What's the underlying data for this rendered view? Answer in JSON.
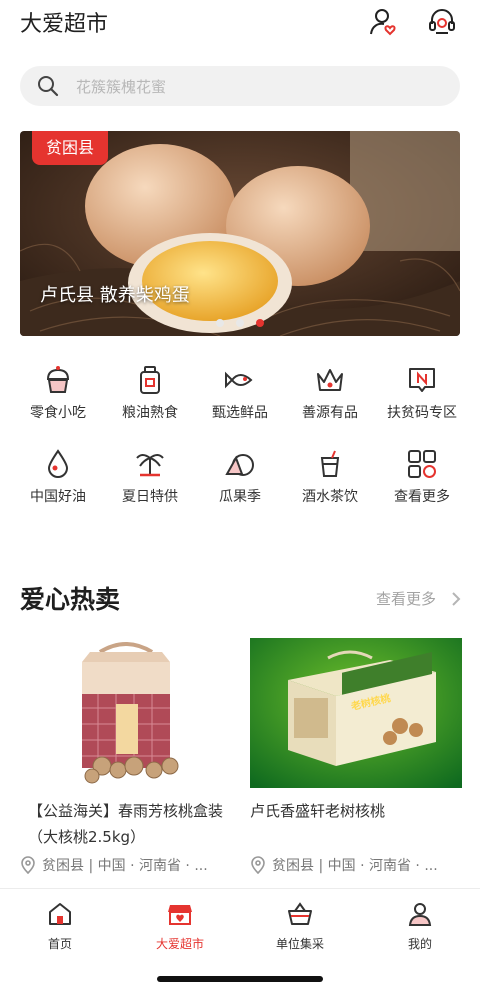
{
  "header": {
    "title": "大爱超市",
    "icons": [
      "user-heart-icon",
      "headset-icon"
    ]
  },
  "search": {
    "placeholder": "花簇簇槐花蜜"
  },
  "banner": {
    "tag": "贫困县",
    "caption": "卢氏县 散养柴鸡蛋",
    "dots_total": 3,
    "active_dot": 3
  },
  "categories": [
    {
      "label": "零食小吃",
      "icon": "cupcake-icon"
    },
    {
      "label": "粮油熟食",
      "icon": "oil-bottle-icon"
    },
    {
      "label": "甄选鲜品",
      "icon": "fish-icon"
    },
    {
      "label": "善源有品",
      "icon": "crown-icon"
    },
    {
      "label": "扶贫码专区",
      "icon": "chat-n-icon"
    },
    {
      "label": "中国好油",
      "icon": "oil-drop-icon"
    },
    {
      "label": "夏日特供",
      "icon": "palm-tree-icon"
    },
    {
      "label": "瓜果季",
      "icon": "fruit-icon"
    },
    {
      "label": "酒水茶饮",
      "icon": "drink-cup-icon"
    },
    {
      "label": "查看更多",
      "icon": "grid-more-icon"
    }
  ],
  "section": {
    "title": "爱心热卖",
    "more": "查看更多"
  },
  "products": [
    {
      "title": "【公益海关】春雨芳核桃盒装（大核桃2.5kg）",
      "location": "贫困县 | 中国 · 河南省 · ..."
    },
    {
      "title": "卢氏香盛轩老树核桃",
      "location": "贫困县 | 中国 · 河南省 · ...",
      "box_text": "老树核桃"
    }
  ],
  "tabs": [
    {
      "label": "首页",
      "icon": "home-icon",
      "active": false
    },
    {
      "label": "大爱超市",
      "icon": "store-icon",
      "active": true
    },
    {
      "label": "单位集采",
      "icon": "basket-icon",
      "active": false
    },
    {
      "label": "我的",
      "icon": "profile-icon",
      "active": false
    }
  ],
  "colors": {
    "accent": "#e5342f",
    "text": "#333333",
    "muted": "#a3a3a3"
  }
}
